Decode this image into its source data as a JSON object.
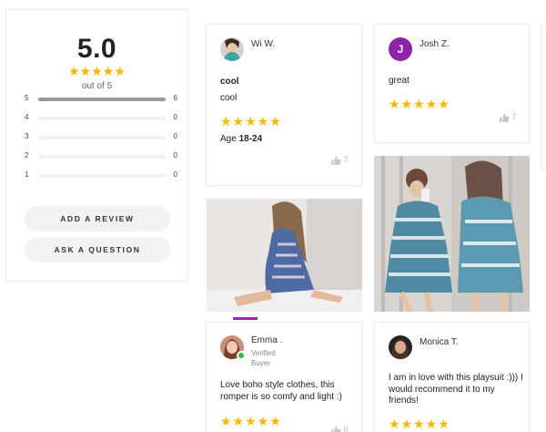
{
  "summary": {
    "average": "5.0",
    "stars": "★★★★★",
    "out_of": "out of 5",
    "distribution": [
      {
        "stars": "5",
        "count": "6",
        "fraction": 1.0
      },
      {
        "stars": "4",
        "count": "0",
        "fraction": 0
      },
      {
        "stars": "3",
        "count": "0",
        "fraction": 0
      },
      {
        "stars": "2",
        "count": "0",
        "fraction": 0
      },
      {
        "stars": "1",
        "count": "0",
        "fraction": 0
      }
    ],
    "add_review_label": "ADD A REVIEW",
    "ask_question_label": "ASK A QUESTION"
  },
  "reviews": [
    {
      "name": "Wi W.",
      "title": "cool",
      "body": "cool",
      "stars": "★★★★★",
      "age_label": "Age",
      "age_value": "18-24",
      "helpful": "7"
    },
    {
      "name": "Josh Z.",
      "initial": "J",
      "body": "great",
      "stars": "★★★★★",
      "helpful": "7"
    },
    {
      "name": "Emma .",
      "badge_line1": "Verified",
      "badge_line2": "Buyer",
      "body": "Love boho style clothes, this romper is so comfy and light :)",
      "stars": "★★★★★",
      "helpful": "0"
    },
    {
      "name": "Monica T.",
      "body": "I am in love with this playsuit :))) I would recommend it to my friends!",
      "stars": "★★★★★"
    }
  ],
  "colors": {
    "star": "#f5b800",
    "avatar_purple": "#8e24aa",
    "indicator": "#9c27b0"
  }
}
